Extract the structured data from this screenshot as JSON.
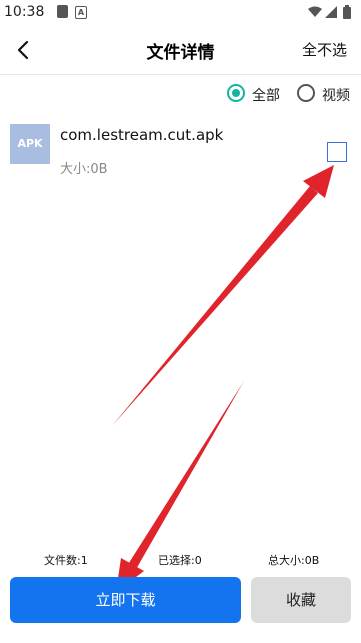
{
  "status_bar": {
    "time": "10:38",
    "icons": [
      "gallery-icon",
      "a-icon",
      "wifi-icon",
      "signal-icon",
      "battery-icon"
    ]
  },
  "header": {
    "title": "文件详情",
    "deselect_all": "全不选",
    "back_icon": "chevron-left-icon"
  },
  "filters": {
    "options": [
      {
        "label": "全部",
        "selected": true
      },
      {
        "label": "视频",
        "selected": false
      }
    ]
  },
  "files": [
    {
      "icon_text": "APK",
      "name": "com.lestream.cut.apk",
      "size": "大小:0B",
      "checked": false
    }
  ],
  "stats": {
    "file_count": "文件数:1",
    "selected": "已选择:0",
    "total_size": "总大小:0B"
  },
  "actions": {
    "download": "立即下载",
    "favorite": "收藏"
  },
  "colors": {
    "accent": "#12b5a0",
    "primary_button": "#1474f0",
    "secondary_button": "#dcdcdc",
    "annotation_arrow": "#e0242b"
  }
}
